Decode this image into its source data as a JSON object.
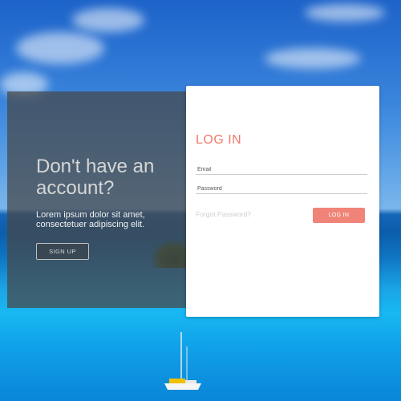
{
  "left_panel": {
    "title": "Don't have an account?",
    "text": "Lorem ipsum dolor sit amet, consectetuer adipiscing elit.",
    "signup_label": "SIGN UP"
  },
  "form": {
    "title": "LOG IN",
    "email_placeholder": "Email",
    "password_placeholder": "Password",
    "forgot_label": "Forgot Password?",
    "login_label": "LOG IN"
  },
  "colors": {
    "accent": "#ee7a6b",
    "button": "#f08478",
    "overlay": "#464646"
  }
}
